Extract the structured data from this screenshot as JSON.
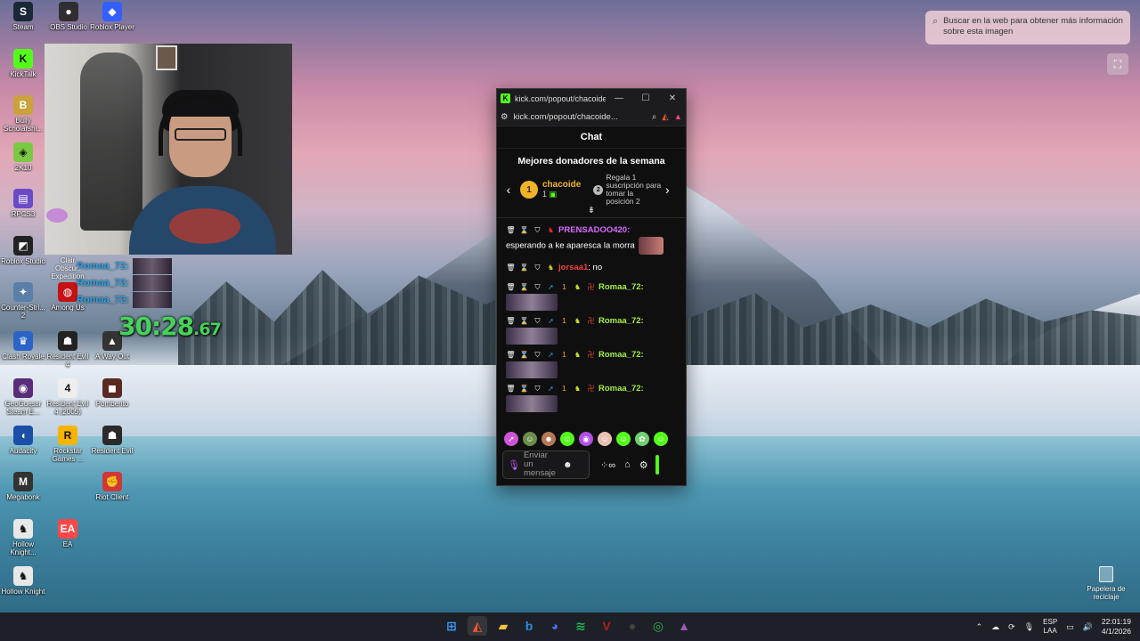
{
  "desktop": {
    "icons": [
      {
        "id": "steam",
        "label": "Steam",
        "icon": "steam-icon",
        "color": "#1b2838",
        "glyph": "S"
      },
      {
        "id": "obs",
        "label": "OBS Studio",
        "icon": "obs-icon",
        "color": "#302e31",
        "glyph": "●"
      },
      {
        "id": "roblox-player",
        "label": "Roblox Player",
        "icon": "roblox-icon",
        "color": "#335fff",
        "glyph": "◆"
      },
      {
        "id": "kicktalk",
        "label": "KickTalk",
        "icon": "kicktalk-icon",
        "color": "#53fc18",
        "glyph": "K"
      },
      {
        "id": "bully",
        "label": "Bully Scholarshi...",
        "icon": "bully-icon",
        "color": "#c9a23a",
        "glyph": "B"
      },
      {
        "id": "2k10",
        "label": "2K10",
        "icon": "game-icon",
        "color": "#7ac943",
        "glyph": "◈"
      },
      {
        "id": "rpcs3",
        "label": "RPCS3",
        "icon": "rpcs3-icon",
        "color": "#6b4ac8",
        "glyph": "▤"
      },
      {
        "id": "roblox-studio",
        "label": "Roblox Studio",
        "icon": "roblox-studio-icon",
        "color": "#222",
        "glyph": "◩"
      },
      {
        "id": "counter-strike",
        "label": "Counter-Stri... 2",
        "icon": "counter-strike-icon",
        "color": "#5a7fa8",
        "glyph": "✦"
      },
      {
        "id": "among-us",
        "label": "Among Us",
        "icon": "among-us-icon",
        "color": "#c51111",
        "glyph": "◍"
      },
      {
        "id": "clash-royale",
        "label": "Clash Royale",
        "icon": "clash-royale-icon",
        "color": "#2b64c6",
        "glyph": "♛"
      },
      {
        "id": "re4",
        "label": "Resident Evil 4",
        "icon": "resident-evil-icon",
        "color": "#222",
        "glyph": "☗"
      },
      {
        "id": "a-way-out",
        "label": "A Way Out",
        "icon": "a-way-out-icon",
        "color": "#333",
        "glyph": "▲"
      },
      {
        "id": "geoguessr",
        "label": "GeoGuessr Steam E...",
        "icon": "geoguessr-icon",
        "color": "#5a2c7a",
        "glyph": "◉"
      },
      {
        "id": "re4-2005",
        "label": "Resident Evil 4 (2005)",
        "icon": "resident-evil-icon",
        "color": "#eee",
        "glyph": "4"
      },
      {
        "id": "pomberito",
        "label": "Pomberito",
        "icon": "pomberito-icon",
        "color": "#5a2a22",
        "glyph": "◼"
      },
      {
        "id": "audacity",
        "label": "Audacity",
        "icon": "audacity-icon",
        "color": "#1b4fa8",
        "glyph": "◖"
      },
      {
        "id": "rockstar",
        "label": "Rockstar Games ...",
        "icon": "rockstar-icon",
        "color": "#f5b400",
        "glyph": "R"
      },
      {
        "id": "resident-evil",
        "label": "Resident Evil",
        "icon": "resident-evil-icon",
        "color": "#2a2a2a",
        "glyph": "☗"
      },
      {
        "id": "megabonk",
        "label": "Megabonk",
        "icon": "megabonk-icon",
        "color": "#333",
        "glyph": "M"
      },
      {
        "id": "riot",
        "label": "Riot Client",
        "icon": "riot-icon",
        "color": "#d13639",
        "glyph": "✊"
      },
      {
        "id": "hollow-knight-1",
        "label": "Hollow Knight...",
        "icon": "hollow-knight-icon",
        "color": "#e8e8e8",
        "glyph": "♞"
      },
      {
        "id": "ea",
        "label": "EA",
        "icon": "ea-icon",
        "color": "#ff4747",
        "glyph": "EA"
      },
      {
        "id": "hollow-knight-2",
        "label": "Hollow Knight",
        "icon": "hollow-knight-icon",
        "color": "#e8e8e8",
        "glyph": "♞"
      }
    ],
    "recycle_bin": "Papelera de reciclaje"
  },
  "overlay": {
    "partial_label": "Clair Obscur: Expedition",
    "rows": [
      "Romaa_72:",
      "Romaa_72:",
      "Romaa_72:"
    ],
    "timer_main": "30:28",
    "timer_ms": ".67"
  },
  "lens": {
    "tooltip": "Buscar en la web para obtener más información sobre esta imagen"
  },
  "popup": {
    "tab_title": "kick.com/popout/chacoide/...",
    "url": "kick.com/popout/chacoide...",
    "chat_title": "Chat",
    "donors_title": "Mejores donadores de la semana",
    "top_donor": {
      "rank": "1",
      "name": "chacoide",
      "count": "1"
    },
    "second_slot": {
      "rank": "2",
      "text": "Regala 1 suscripción para tomar la posición 2"
    },
    "messages": [
      {
        "user": "PRENSADOO420:",
        "text": "esperando a ke aparesca la morra",
        "color": "#d86bff"
      },
      {
        "user": "jorsaa1",
        "text": ": no",
        "color": "#f54242"
      },
      {
        "user": "Romaa_72:",
        "text": "",
        "color": "#a7f03f"
      },
      {
        "user": "Romaa_72:",
        "text": "",
        "color": "#a7f03f"
      },
      {
        "user": "Romaa_72:",
        "text": "",
        "color": "#a7f03f"
      },
      {
        "user": "Romaa_72:",
        "text": "",
        "color": "#a7f03f"
      }
    ],
    "input_placeholder": "Enviar un mensaje",
    "accent": "#53fc18"
  },
  "taskbar": {
    "apps": [
      {
        "id": "start",
        "icon": "windows-start-icon",
        "glyph": "⊞",
        "color": "#3b9bff"
      },
      {
        "id": "brave",
        "icon": "brave-icon",
        "glyph": "◭",
        "color": "#fb542b"
      },
      {
        "id": "explorer",
        "icon": "folder-icon",
        "glyph": "▰",
        "color": "#f5c242"
      },
      {
        "id": "bing",
        "icon": "bing-icon",
        "glyph": "b",
        "color": "#2a8fe0"
      },
      {
        "id": "discord",
        "icon": "discord-icon",
        "glyph": "◕",
        "color": "#5865f2"
      },
      {
        "id": "spotify",
        "icon": "spotify-icon",
        "glyph": "≋",
        "color": "#1db954"
      },
      {
        "id": "voicemeeter",
        "icon": "voicemeeter-icon",
        "glyph": "V",
        "color": "#b51f1f"
      },
      {
        "id": "obs-task",
        "icon": "obs-icon",
        "glyph": "●",
        "color": "#444"
      },
      {
        "id": "chrome",
        "icon": "chrome-icon",
        "glyph": "◎",
        "color": "#34a853"
      },
      {
        "id": "app-tri",
        "icon": "triangle-app-icon",
        "glyph": "▲",
        "color": "#9b59b6"
      }
    ],
    "lang_top": "ESP",
    "lang_bottom": "LAA",
    "time": "22:01:19",
    "date": "4/1/2026"
  }
}
